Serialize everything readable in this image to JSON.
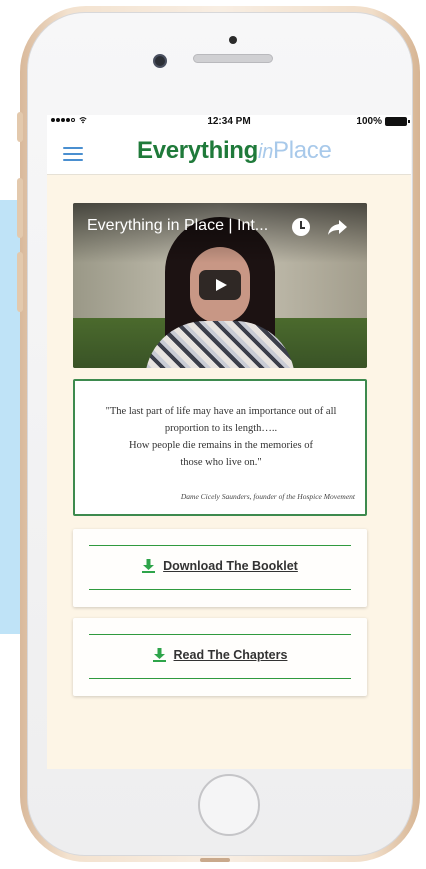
{
  "status_bar": {
    "time": "12:34 PM",
    "battery": "100%",
    "signal_icon": "signal-dots-icon",
    "wifi_icon": "wifi-icon"
  },
  "header": {
    "logo_main": "Everything",
    "logo_in": "in",
    "logo_place": "Place",
    "menu_icon": "hamburger-menu-icon",
    "brand_color": "#1f7a3a",
    "accent_color": "#a8c9ea"
  },
  "video": {
    "title": "Everything in Place | Int...",
    "watch_later_icon": "clock-icon",
    "share_icon": "share-arrow-icon",
    "play_icon": "play-icon"
  },
  "quote": {
    "lines": [
      "\"The last part of  life may have an importance out of  all",
      "proportion to its length…..",
      "How people die remains in the memories of",
      "those who live on.\""
    ],
    "attribution": "Dame Cicely Saunders, founder of  the Hospice Movement",
    "border_color": "#3d8a4e"
  },
  "actions": {
    "download_label": "Download The Booklet",
    "read_label": "Read The Chapters",
    "icon": "download-arrow-icon",
    "rule_color": "#2f9a3e"
  }
}
